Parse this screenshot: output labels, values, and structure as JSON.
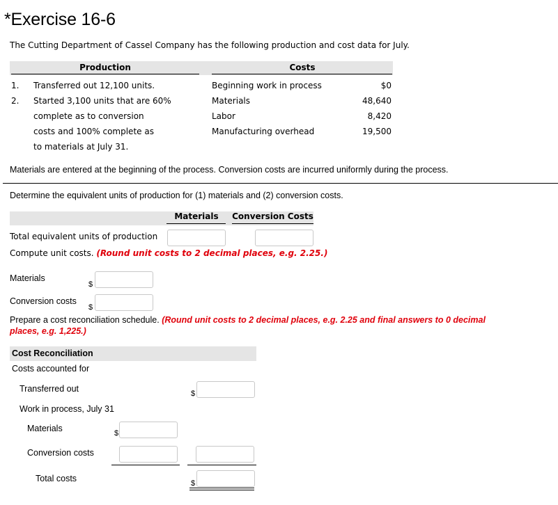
{
  "title": "*Exercise 16-6",
  "intro": "The Cutting Department of Cassel Company has the following production and cost data for July.",
  "production": {
    "header": "Production",
    "items": [
      {
        "num": "1.",
        "lines": [
          "Transferred out 12,100 units."
        ]
      },
      {
        "num": "2.",
        "lines": [
          "Started 3,100 units that are 60%",
          "complete as to conversion",
          "costs and 100% complete as",
          "to materials at July 31."
        ]
      }
    ]
  },
  "costs": {
    "header": "Costs",
    "rows": [
      {
        "label": "Beginning work in process",
        "value": "$0"
      },
      {
        "label": "Materials",
        "value": "48,640"
      },
      {
        "label": "Labor",
        "value": "8,420"
      },
      {
        "label": "Manufacturing overhead",
        "value": "19,500"
      }
    ]
  },
  "note": "Materials are entered at the beginning of the process. Conversion costs are incurred uniformly during the process.",
  "part1": {
    "instruction": "Determine the equivalent units of production for (1) materials and (2) conversion costs.",
    "col_materials": "Materials",
    "col_conversion": "Conversion Costs",
    "row_label": "Total equivalent units of production",
    "materials_value": "",
    "conversion_value": ""
  },
  "part2": {
    "instruction": "Compute unit costs.",
    "hint": "(Round unit costs to 2 decimal places, e.g. 2.25.)",
    "materials_label": "Materials",
    "conversion_label": "Conversion costs",
    "currency": "$",
    "materials_value": "",
    "conversion_value": ""
  },
  "part3": {
    "instruction": "Prepare a cost reconciliation schedule.",
    "hint_line1": "(Round unit costs to 2 decimal places, e.g. 2.25 and final answers to 0 decimal",
    "hint_line2": "places, e.g. 1,225.)",
    "header": "Cost Reconciliation",
    "subheader": "Costs accounted for",
    "transferred_out_label": "Transferred out",
    "wip_label": "Work in process, July 31",
    "materials_label": "Materials",
    "conversion_label": "Conversion costs",
    "total_label": "Total costs",
    "currency": "$",
    "transferred_out_value": "",
    "wip_materials_value": "",
    "wip_conversion_value": "",
    "wip_total_value": "",
    "total_costs_value": ""
  }
}
